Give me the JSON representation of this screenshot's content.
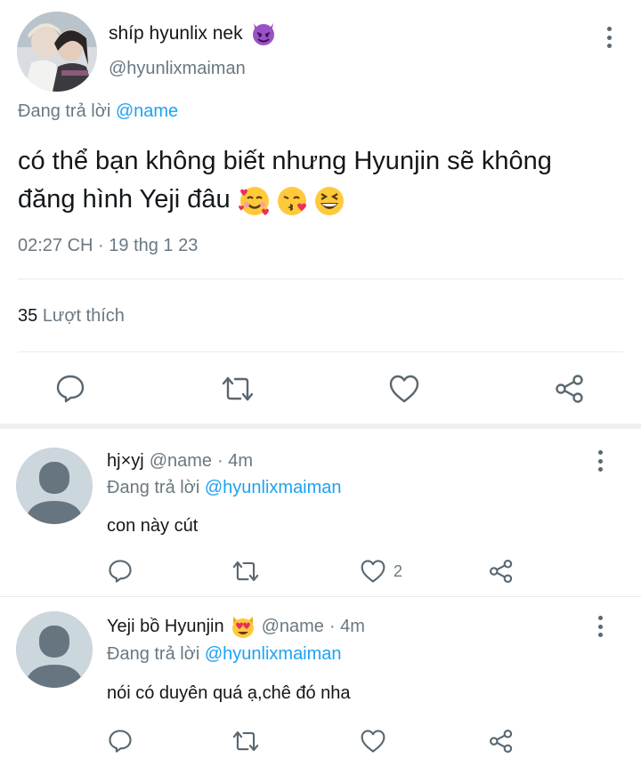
{
  "tweet": {
    "display_name": "shíp hyunlix nek",
    "display_emoji": "smiling-imp-emoji",
    "handle": "@hyunlixmaiman",
    "reply_prefix": "Đang trả lời",
    "reply_to": "@name",
    "text_line1": "có thể bạn không biết nhưng Hyunjin sẽ không",
    "text_line2": "đăng hình Yeji đâu",
    "text_emojis": [
      "smiling-face-with-hearts-emoji",
      "kissing-face-emoji",
      "grinning-squinting-emoji"
    ],
    "timestamp": "02:27 CH · 19 thg 1 23",
    "likes_count": "35",
    "likes_label": "Lượt thích",
    "actions": [
      "reply-icon",
      "retweet-icon",
      "like-icon",
      "share-icon"
    ]
  },
  "replies": [
    {
      "name": "hj×yj",
      "name_emoji": "",
      "handle": "@name",
      "time": "· 4m",
      "reply_prefix": "Đang trả lời",
      "reply_to": "@hyunlixmaiman",
      "text": "con này cút",
      "like_count": "2"
    },
    {
      "name": "Yeji bồ Hyunjin",
      "name_emoji": "smiling-cat-with-heart-eyes-emoji",
      "handle": "@name",
      "time": "· 4m",
      "reply_prefix": "Đang trả lời",
      "reply_to": "@hyunlixmaiman",
      "text": "nói có duyên quá ạ,chê đó nha",
      "like_count": ""
    }
  ],
  "colors": {
    "accent": "#1da1f2",
    "text": "#14171a",
    "secondary": "#697882",
    "icon": "#5b6770",
    "divider": "#e6ecf0"
  }
}
